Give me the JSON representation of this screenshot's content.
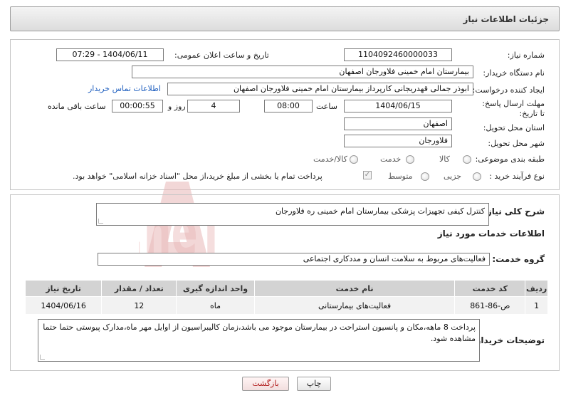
{
  "header": {
    "title": "جزئیات اطلاعات نیاز"
  },
  "form": {
    "need_number_label": "شماره نیاز:",
    "need_number": "1104092460000033",
    "announce_label": "تاریخ و ساعت اعلان عمومی:",
    "announce_value": "1404/06/11 - 07:29",
    "buyer_org_label": "نام دستگاه خریدار:",
    "buyer_org": "بیمارستان امام خمینی فلاورجان اصفهان",
    "creator_label": "ایجاد کننده درخواست:",
    "creator": "ابوذر جمالی قهدریجانی کارپرداز بیمارستان امام خمینی فلاورجان اصفهان",
    "contact_link": "اطلاعات تماس خریدار",
    "deadline_label": "مهلت ارسال پاسخ: تا تاریخ:",
    "deadline_date": "1404/06/15",
    "time_label": "ساعت",
    "deadline_time": "08:00",
    "days_value": "4",
    "days_label": "روز و",
    "remaining_time": "00:00:55",
    "remaining_label": "ساعت باقی مانده",
    "province_label": "استان محل تحویل:",
    "province": "اصفهان",
    "city_label": "شهر محل تحویل:",
    "city": "فلاورجان",
    "category_label": "طبقه بندی موضوعی:",
    "category_options": [
      "کالا",
      "خدمت",
      "کالا/خدمت"
    ],
    "process_label": "نوع فرآیند خرید :",
    "process_options": [
      "جزیی",
      "متوسط"
    ],
    "payment_note": "پرداخت تمام یا بخشی از مبلغ خرید،از محل \"اسناد خزانه اسلامی\" خواهد بود."
  },
  "summary": {
    "general_desc_label": "شرح کلی نیاز:",
    "general_desc": "کنترل کیفی تجهیزات پزشکی بیمارستان امام خمینی ره فلاورجان",
    "services_info_title": "اطلاعات خدمات مورد نیاز",
    "service_group_label": "گروه خدمت:",
    "service_group": "فعالیت‌های مربوط به سلامت انسان و مددکاری اجتماعی"
  },
  "table": {
    "headers": [
      "ردیف",
      "کد خدمت",
      "نام خدمت",
      "واحد اندازه گیری",
      "تعداد / مقدار",
      "تاریخ نیاز"
    ],
    "rows": [
      [
        "1",
        "ص-86-861",
        "فعالیت‌های بیمارستانی",
        "ماه",
        "12",
        "1404/06/16"
      ]
    ]
  },
  "buyer_notes": {
    "label": "توضیحات خریدار:",
    "text": "پرداخت 8 ماهه،مکان و پانسیون استراحت در بیمارستان موجود می باشد،زمان کالیبراسیون از اوایل مهر ماه،مدارک پیوستی حتما حتما مشاهده شود."
  },
  "buttons": {
    "print": "چاپ",
    "back": "بازگشت"
  },
  "watermark_text": "AriaTender.neT",
  "colors": {
    "link": "#1f5fbf",
    "back_button_text": "#b01818",
    "watermark": "#e9b7b7"
  }
}
